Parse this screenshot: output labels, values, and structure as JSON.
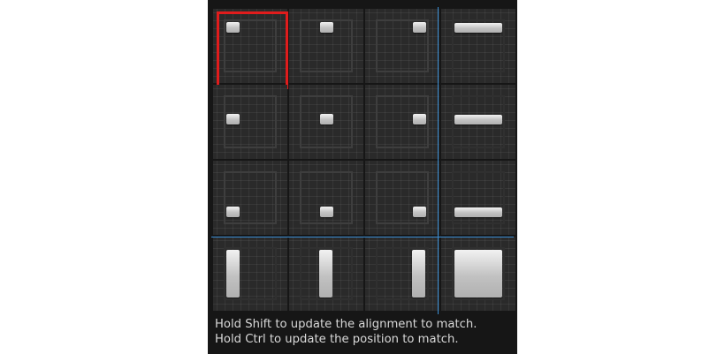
{
  "anchor_presets": [
    {
      "name": "anchor-top-left-button",
      "row": 0,
      "col": 0,
      "selected": true
    },
    {
      "name": "anchor-top-center-button",
      "row": 0,
      "col": 1
    },
    {
      "name": "anchor-top-right-button",
      "row": 0,
      "col": 2
    },
    {
      "name": "anchor-top-stretch-horizontal-button",
      "row": 0,
      "col": 3
    },
    {
      "name": "anchor-middle-left-button",
      "row": 1,
      "col": 0
    },
    {
      "name": "anchor-center-button",
      "row": 1,
      "col": 1
    },
    {
      "name": "anchor-middle-right-button",
      "row": 1,
      "col": 2
    },
    {
      "name": "anchor-middle-stretch-horizontal-button",
      "row": 1,
      "col": 3
    },
    {
      "name": "anchor-bottom-left-button",
      "row": 2,
      "col": 0
    },
    {
      "name": "anchor-bottom-center-button",
      "row": 2,
      "col": 1
    },
    {
      "name": "anchor-bottom-right-button",
      "row": 2,
      "col": 2
    },
    {
      "name": "anchor-bottom-stretch-horizontal-button",
      "row": 2,
      "col": 3
    },
    {
      "name": "anchor-left-stretch-vertical-button",
      "row": 3,
      "col": 0
    },
    {
      "name": "anchor-center-stretch-vertical-button",
      "row": 3,
      "col": 1
    },
    {
      "name": "anchor-right-stretch-vertical-button",
      "row": 3,
      "col": 2
    },
    {
      "name": "anchor-stretch-both-button",
      "row": 3,
      "col": 3
    }
  ],
  "hint": {
    "line1": "Hold Shift to update the alignment to match.",
    "line2": "Hold Ctrl to update the position to match."
  },
  "colors": {
    "panel_bg": "#161616",
    "cell_bg": "#2a2a2a",
    "selection": "#e01c1c",
    "guide_line": "#3b8fd6"
  }
}
